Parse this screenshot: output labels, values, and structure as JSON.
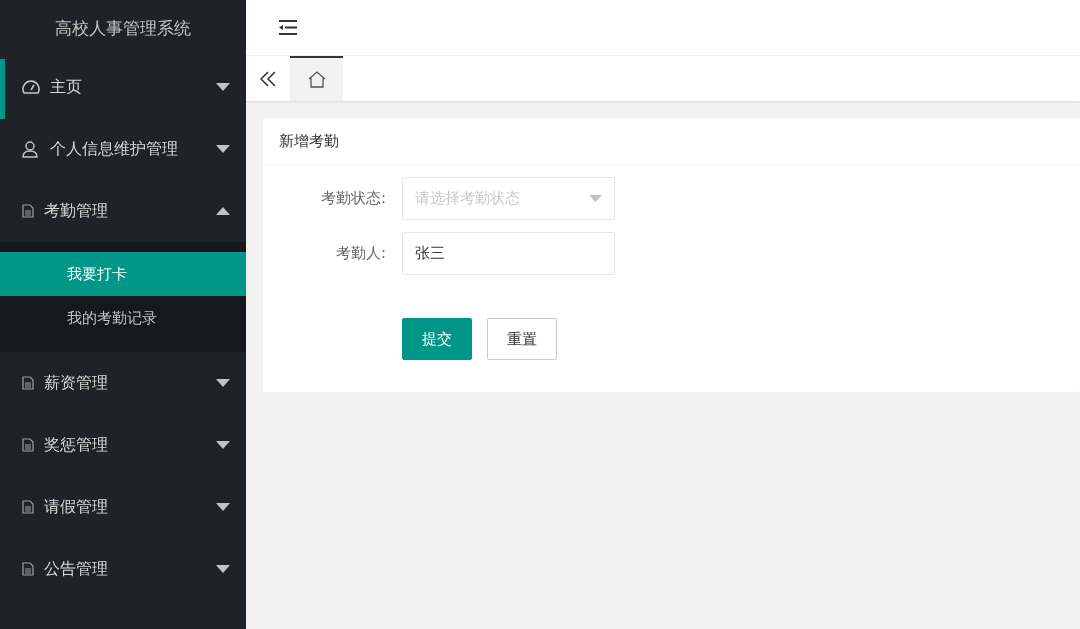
{
  "sidebar": {
    "title": "高校人事管理系统",
    "items": [
      {
        "label": "主页",
        "kind": "gauge",
        "expanded": false,
        "indicator": true
      },
      {
        "label": "个人信息维护管理",
        "kind": "user",
        "expanded": false,
        "indicator": false
      },
      {
        "label": "考勤管理",
        "kind": "doc",
        "expanded": true,
        "indicator": false,
        "children": [
          {
            "label": "我要打卡",
            "selected": true
          },
          {
            "label": "我的考勤记录",
            "selected": false
          }
        ]
      },
      {
        "label": "薪资管理",
        "kind": "doc",
        "expanded": false,
        "indicator": false
      },
      {
        "label": "奖惩管理",
        "kind": "doc",
        "expanded": false,
        "indicator": false
      },
      {
        "label": "请假管理",
        "kind": "doc",
        "expanded": false,
        "indicator": false
      },
      {
        "label": "公告管理",
        "kind": "doc",
        "expanded": false,
        "indicator": false
      }
    ]
  },
  "tabs": [
    {
      "kind": "home",
      "selected": true
    }
  ],
  "form": {
    "title": "新增考勤",
    "fields": [
      {
        "kind": "select",
        "label": "考勤状态:",
        "placeholder": "请选择考勤状态"
      },
      {
        "kind": "text",
        "label": "考勤人:",
        "value": "张三"
      }
    ],
    "buttons": [
      {
        "label": "提交",
        "kind": "primary"
      },
      {
        "label": "重置",
        "kind": "secondary"
      }
    ]
  }
}
